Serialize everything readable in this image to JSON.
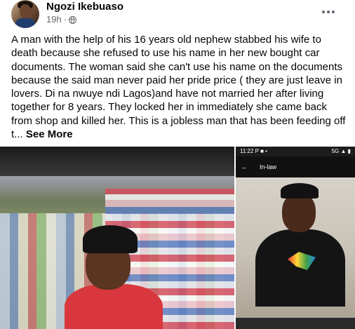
{
  "post": {
    "author": "Ngozi Ikebuaso",
    "time": "19h",
    "separator": "·",
    "body": "A man with the help of his 16 years old nephew stabbed his wife to death because she refused to use his name in her new bought car documents. The woman said she can't use his name on the documents because the said man never paid her pride price ( they are just leave in lovers. Di na nwuye ndi Lagos)and have not married her after living together for 8 years. They locked her in immediately she came back from shop and killed her. This is a jobless man that has been feeding off t...",
    "see_more": "See More"
  },
  "icons": {
    "privacy": "globe-icon",
    "menu": "more-horizontal-icon"
  },
  "photos": {
    "right": {
      "status_time": "11:22",
      "status_icons": "P ■ •",
      "status_right": "5G ▲ ▮",
      "back_glyph": "←",
      "title": "In-law"
    }
  },
  "colors": {
    "text": "#050505",
    "secondary": "#65676b"
  }
}
